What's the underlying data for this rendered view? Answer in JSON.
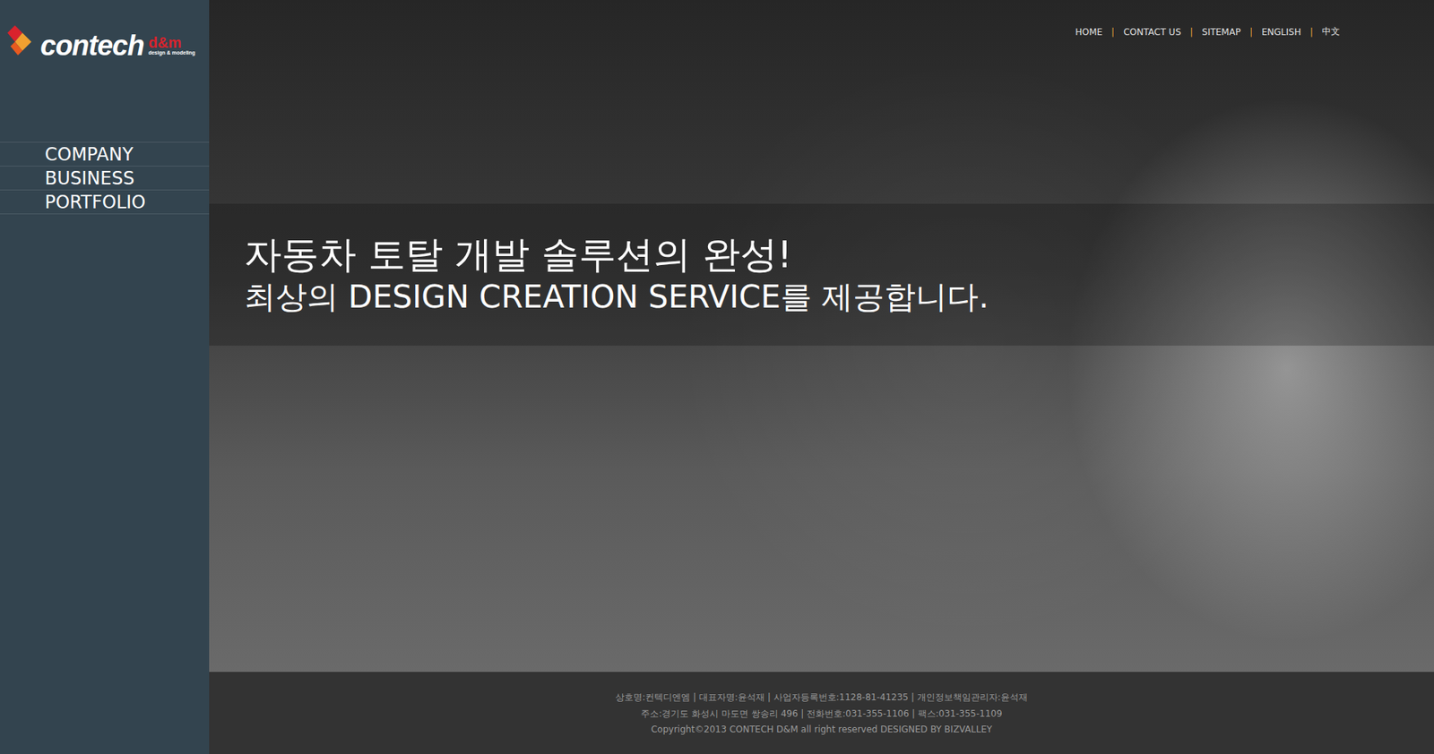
{
  "logo": {
    "name": "contech",
    "suffix": "d&m",
    "tagline": "design & modeling"
  },
  "header": {
    "separator": "|",
    "links": [
      "HOME",
      "CONTACT US",
      "SITEMAP",
      "ENGLISH",
      "中文"
    ]
  },
  "sidebar": {
    "items": [
      {
        "label": "COMPANY",
        "selected": false
      },
      {
        "label": "BUSINESS",
        "selected": false
      },
      {
        "label": "PORTFOLIO",
        "selected": false
      }
    ]
  },
  "hero": {
    "title": "자동차 토탈 개발 솔루션의 완성!",
    "subtitle": "최상의 DESIGN CREATION SERVICE를 제공합니다."
  },
  "footer": {
    "lines": [
      "상호명:컨텍디엔엠 | 대표자명:윤석재 | 사업자등록번호:1128-81-41235 | 개인정보책임관리자:윤석재",
      "주소:경기도 화성시 마도면 쌍송리 496 | 전화번호:031-355-1106 | 팩스:031-355-1109",
      "Copyright©2013 CONTECH D&M all right reserved DESIGNED BY BIZVALLEY"
    ]
  }
}
